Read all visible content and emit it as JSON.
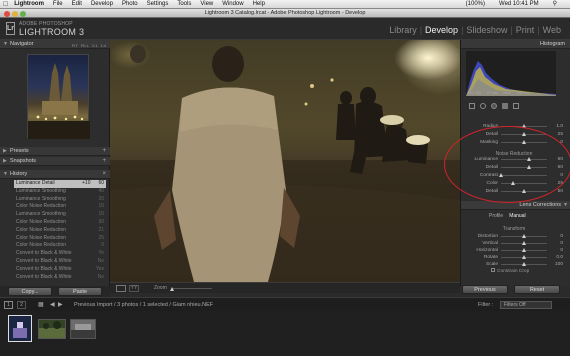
{
  "menubar": {
    "apple": "",
    "app": "Lightroom",
    "items": [
      "File",
      "Edit",
      "Develop",
      "Photo",
      "Settings",
      "Tools",
      "View",
      "Window",
      "Help"
    ],
    "status": [
      "(100%)",
      "Wed 10:41 PM"
    ]
  },
  "window": {
    "title": "Lightroom 3 Catalog.lrcat - Adobe Photoshop Lightroom - Develop"
  },
  "header": {
    "logo": "Lr",
    "brand_small": "ADOBE PHOTOSHOP",
    "brand": "LIGHTROOM 3",
    "modules": [
      "Library",
      "Develop",
      "Slideshow",
      "Print",
      "Web"
    ],
    "active_module": "Develop"
  },
  "left_panel": {
    "navigator": {
      "title": "Navigator",
      "buttons": [
        "FIT",
        "FILL",
        "1:1",
        "1:4"
      ]
    },
    "presets": {
      "title": "Presets"
    },
    "snapshots": {
      "title": "Snapshots"
    },
    "history": {
      "title": "History",
      "items": [
        {
          "label": "Luminance Detail",
          "a": "+10",
          "b": "60",
          "selected": true
        },
        {
          "label": "Luminance Smoothing",
          "a": "",
          "b": "40"
        },
        {
          "label": "Luminance Smoothing",
          "a": "",
          "b": "20"
        },
        {
          "label": "Color Noise Reduction",
          "a": "",
          "b": "10"
        },
        {
          "label": "Luminance Smoothing",
          "a": "",
          "b": "10"
        },
        {
          "label": "Color Noise Reduction",
          "a": "",
          "b": "30"
        },
        {
          "label": "Color Noise Reduction",
          "a": "",
          "b": "21"
        },
        {
          "label": "Color Noise Reduction",
          "a": "",
          "b": "25"
        },
        {
          "label": "Color Noise Reduction",
          "a": "",
          "b": "0"
        },
        {
          "label": "Convert to Black & White",
          "a": "",
          "b": "Ye"
        },
        {
          "label": "Convert to Black & White",
          "a": "",
          "b": "No"
        },
        {
          "label": "Convert to Black & White",
          "a": "",
          "b": "Yes"
        },
        {
          "label": "Convert to Black & White",
          "a": "",
          "b": "No"
        }
      ]
    },
    "copy_label": "Copy...",
    "paste_label": "Paste"
  },
  "toolbar": {
    "zoom_label": "Zoom"
  },
  "right_panel": {
    "histogram_title": "Histogram",
    "histogram_info": [
      "ISO 200",
      "17 mm",
      "f/3.5",
      "1/60 sec"
    ],
    "detail_rows": [
      {
        "label": "Radius",
        "value": "1.0"
      },
      {
        "label": "Detail",
        "value": "25"
      },
      {
        "label": "Masking",
        "value": "0"
      }
    ],
    "noise_title": "Noise Reduction",
    "noise_rows": [
      {
        "label": "Luminance",
        "value": "60",
        "pos": 0.6
      },
      {
        "label": "Detail",
        "value": "60",
        "pos": 0.6
      },
      {
        "label": "Contrast",
        "value": "0",
        "pos": 0.0
      },
      {
        "label": "Color",
        "value": "25",
        "pos": 0.25
      },
      {
        "label": "Detail",
        "value": "50",
        "pos": 0.5
      }
    ],
    "lens_title": "Lens Corrections",
    "lens_tabs": [
      "Profile",
      "Manual"
    ],
    "transform_title": "Transform",
    "transform_rows": [
      {
        "label": "Distortion",
        "value": "0"
      },
      {
        "label": "Vertical",
        "value": "0"
      },
      {
        "label": "Horizontal",
        "value": "0"
      },
      {
        "label": "Rotate",
        "value": "0.0"
      },
      {
        "label": "Scale",
        "value": "100"
      }
    ],
    "constrain_label": "Constrain Crop",
    "previous_label": "Previous",
    "reset_label": "Reset"
  },
  "filmstrip": {
    "page1": "1",
    "page2": "2",
    "path": "Previous Import / 3 photos / 1 selected / Giam nhieu.NEF",
    "filter_label": "Filter :",
    "filter_value": "Filters Off"
  },
  "colors": {
    "annotation": "#d0232b",
    "accent": "#f0f0f0"
  }
}
